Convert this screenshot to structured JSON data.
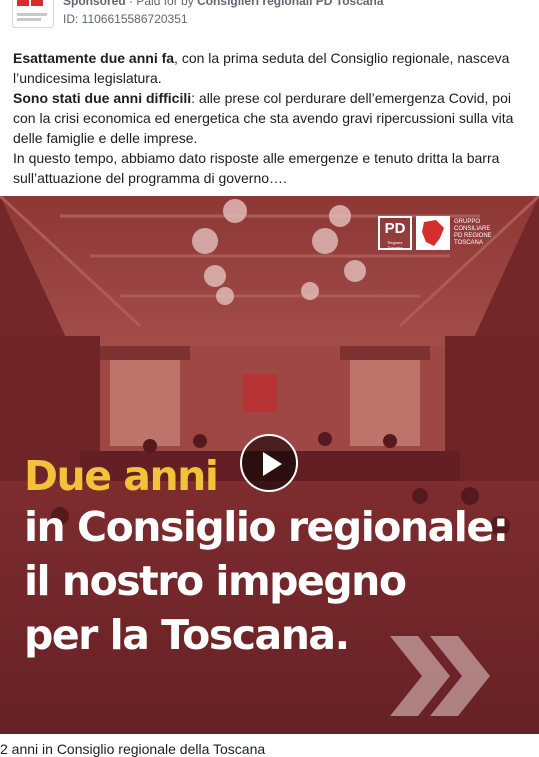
{
  "ad": {
    "sponsored_label": "Sponsored",
    "paid_for_by": "· Paid for by",
    "advertiser": "Consiglieri regionali PD Toscana",
    "ad_id": "ID: 1106615586720351"
  },
  "post": {
    "para1_bold": "Esattamente due anni fa",
    "para1_rest": ", con la prima seduta del Consiglio regionale, nasceva l’undicesima legislatura.",
    "para2_bold": "Sono stati due anni difficili",
    "para2_rest": ": alle prese col perdurare dell’emergenza Covid, poi con la crisi economica ed energetica che sta avendo gravi ripercussioni sulla vita delle famiglie e delle imprese.",
    "para3": "In questo tempo, abbiamo dato risposte alle emergenze e tenuto dritta la barra sull’attuazione del programma di governo…."
  },
  "media": {
    "headline_line1": "Due anni",
    "headline_line2": "in Consiglio regionale:",
    "headline_line3": "il nostro impegno",
    "headline_line4": "per la Toscana.",
    "logo_pd": "PD",
    "logo_sub": "Regione Toscana",
    "logo_group": "Gruppo consiliare PD Regione Toscana",
    "play_icon": "play-icon",
    "arrows_icon": "double-chevron-icon"
  },
  "caption": "2 anni in Consiglio regionale della Toscana",
  "colors": {
    "overlay": "#8c2f31",
    "headline_accent": "#f2c23b",
    "headline_text": "#ffffff"
  }
}
